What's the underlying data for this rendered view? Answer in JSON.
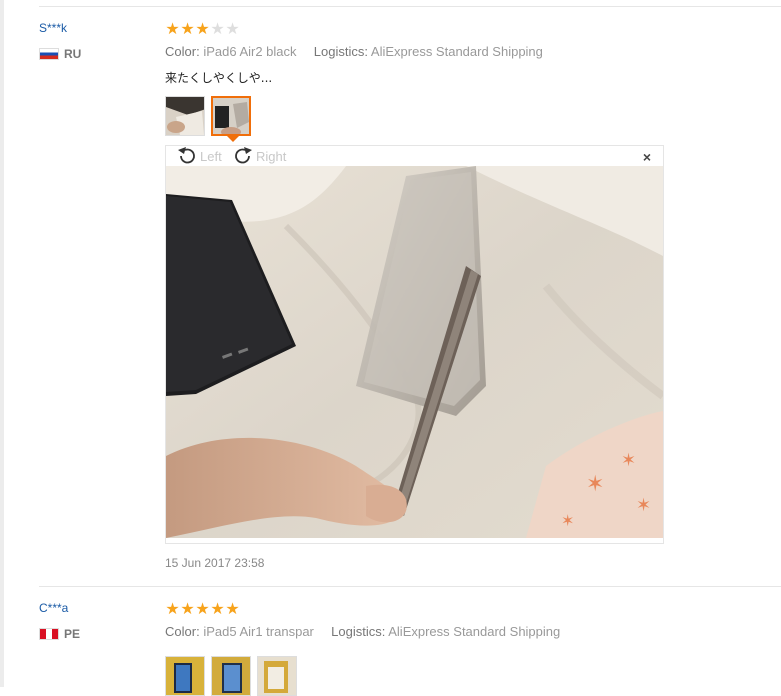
{
  "reviews": [
    {
      "user": "S***k",
      "country": "RU",
      "rating": 3,
      "color_label": "Color:",
      "color_value": "iPad6 Air2 black",
      "logistics_label": "Logistics:",
      "logistics_value": "AliExpress Standard Shipping",
      "text": "来たくしやくしや...",
      "date": "15 Jun 2017 23:58"
    },
    {
      "user": "C***a",
      "country": "PE",
      "rating": 5,
      "color_label": "Color:",
      "color_value": "iPad5 Air1 transpar",
      "logistics_label": "Logistics:",
      "logistics_value": "AliExpress Standard Shipping"
    }
  ],
  "viewer": {
    "rotate_left_label": "Left",
    "rotate_right_label": "Right",
    "close_symbol": "×"
  },
  "colors": {
    "star_on": "#f7a31c",
    "star_off": "#dedede",
    "accent": "#f06e0a",
    "user_link": "#1a5aa6"
  }
}
